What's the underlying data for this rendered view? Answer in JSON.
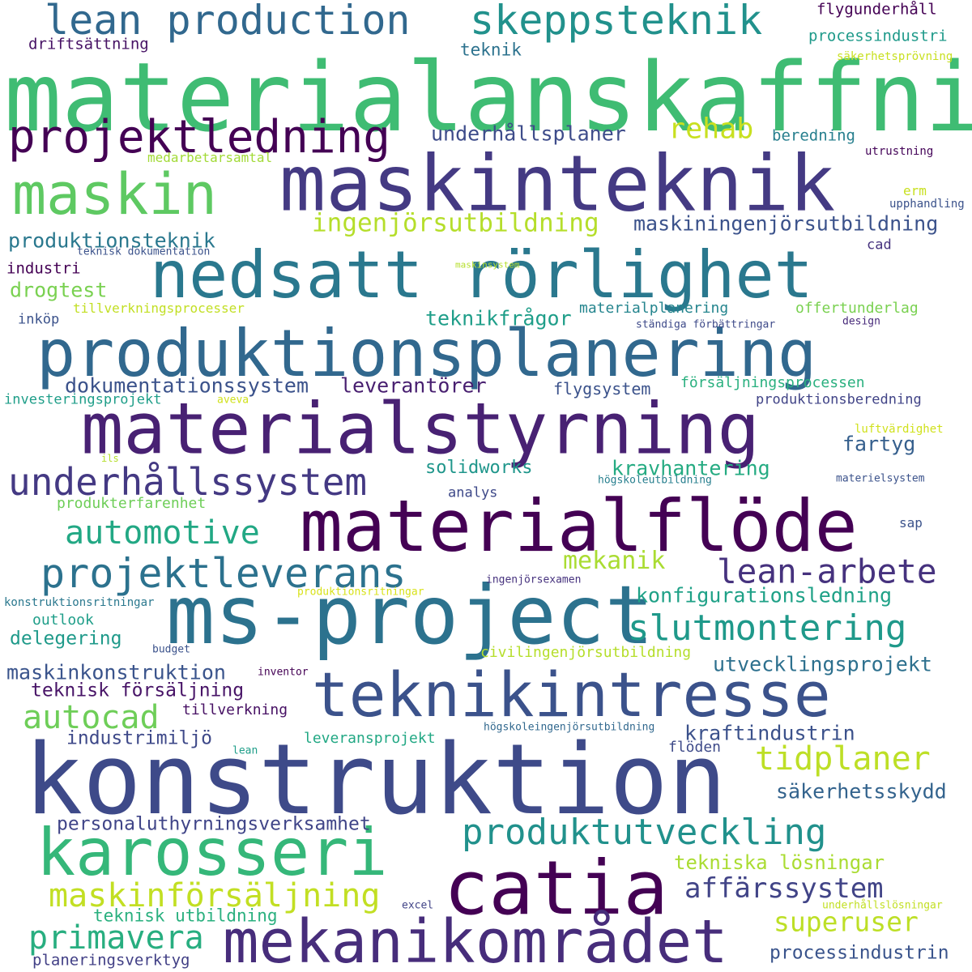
{
  "words": [
    {
      "text": "materialanskaffning",
      "color": "#3fbc73"
    },
    {
      "text": "maskinteknik",
      "color": "#443a83"
    },
    {
      "text": "nedsatt rörlighet",
      "color": "#2a788e"
    },
    {
      "text": "produktionsplanering",
      "color": "#31688e"
    },
    {
      "text": "materialstyrning",
      "color": "#482173"
    },
    {
      "text": "materialflöde",
      "color": "#440154"
    },
    {
      "text": "ms-project",
      "color": "#2c728e"
    },
    {
      "text": "teknikintresse",
      "color": "#3b528b"
    },
    {
      "text": "konstruktion",
      "color": "#3e4a89"
    },
    {
      "text": "karosseri",
      "color": "#35b779"
    },
    {
      "text": "catia",
      "color": "#440154"
    },
    {
      "text": "mekanikområdet",
      "color": "#472d7b"
    },
    {
      "text": "lean production",
      "color": "#31688e"
    },
    {
      "text": "skeppsteknik",
      "color": "#21918c"
    },
    {
      "text": "projektledning",
      "color": "#440154"
    },
    {
      "text": "maskin",
      "color": "#5ec962"
    },
    {
      "text": "underhållssystem",
      "color": "#443983"
    },
    {
      "text": "projektleverans",
      "color": "#2c728e"
    },
    {
      "text": "automotive",
      "color": "#22a884"
    },
    {
      "text": "slutmontering",
      "color": "#1f998a"
    },
    {
      "text": "lean-arbete",
      "color": "#46327e"
    },
    {
      "text": "produktutveckling",
      "color": "#21918c"
    },
    {
      "text": "autocad",
      "color": "#6ece58"
    },
    {
      "text": "tidplaner",
      "color": "#bddf26"
    },
    {
      "text": "maskinförsäljning",
      "color": "#c2df23"
    },
    {
      "text": "primavera",
      "color": "#28ae80"
    },
    {
      "text": "superuser",
      "color": "#bddf26"
    },
    {
      "text": "affärssystem",
      "color": "#414487"
    },
    {
      "text": "rehab",
      "color": "#c8e020"
    },
    {
      "text": "ingenjörsutbildning",
      "color": "#b5de2b"
    },
    {
      "text": "mekanik",
      "color": "#aadc32"
    },
    {
      "text": "underhållsplaner",
      "color": "#3e4c8a"
    },
    {
      "text": "maskiningenjörsutbildning",
      "color": "#3b528b"
    },
    {
      "text": "produktionsteknik",
      "color": "#2a788e"
    },
    {
      "text": "dokumentationssystem",
      "color": "#3b528b"
    },
    {
      "text": "leverantörer",
      "color": "#481f70"
    },
    {
      "text": "teknikfrågor",
      "color": "#1f9e89"
    },
    {
      "text": "drogtest",
      "color": "#7ad151"
    },
    {
      "text": "fartyg",
      "color": "#355f8d"
    },
    {
      "text": "solidworks",
      "color": "#1f968b"
    },
    {
      "text": "kravhantering",
      "color": "#25ab82"
    },
    {
      "text": "konfigurationsledning",
      "color": "#1fa187"
    },
    {
      "text": "utvecklingsprojekt",
      "color": "#2d708e"
    },
    {
      "text": "maskinkonstruktion",
      "color": "#3a548c"
    },
    {
      "text": "teknisk försäljning",
      "color": "#481467"
    },
    {
      "text": "industrimiljö",
      "color": "#3e4989"
    },
    {
      "text": "kraftindustrin",
      "color": "#3b518b"
    },
    {
      "text": "säkerhetsskydd",
      "color": "#33638d"
    },
    {
      "text": "personaluthyrningsverksamhet",
      "color": "#404588"
    },
    {
      "text": "tekniska lösningar",
      "color": "#aadc32"
    },
    {
      "text": "teknisk utbildning",
      "color": "#2ab07f"
    },
    {
      "text": "processindustrin",
      "color": "#3a548c"
    },
    {
      "text": "planeringsverktyg",
      "color": "#424086"
    },
    {
      "text": "flygunderhåll",
      "color": "#440154"
    },
    {
      "text": "processindustri",
      "color": "#1f9a8a"
    },
    {
      "text": "säkerhetsprövning",
      "color": "#c8e020"
    },
    {
      "text": "driftsättning",
      "color": "#471365"
    },
    {
      "text": "teknik",
      "color": "#2c728e"
    },
    {
      "text": "beredning",
      "color": "#277f8e"
    },
    {
      "text": "utrustning",
      "color": "#450559"
    },
    {
      "text": "medarbetarsamtal",
      "color": "#a2da37"
    },
    {
      "text": "erm",
      "color": "#c8e020"
    },
    {
      "text": "upphandling",
      "color": "#3b528b"
    },
    {
      "text": "cad",
      "color": "#46327e"
    },
    {
      "text": "maskinsystem",
      "color": "#b5de2b"
    },
    {
      "text": "teknisk dokumentation",
      "color": "#3b528b"
    },
    {
      "text": "industri",
      "color": "#440154"
    },
    {
      "text": "tillverkningsprocesser",
      "color": "#c2df23"
    },
    {
      "text": "materialplanering",
      "color": "#25858e"
    },
    {
      "text": "offertunderlag",
      "color": "#7ad151"
    },
    {
      "text": "inköp",
      "color": "#3b528b"
    },
    {
      "text": "ständiga förbättringar",
      "color": "#3e4a89"
    },
    {
      "text": "design",
      "color": "#472a7a"
    },
    {
      "text": "flygsystem",
      "color": "#3b528b"
    },
    {
      "text": "försäljningsprocessen",
      "color": "#2ab07f"
    },
    {
      "text": "investeringsprojekt",
      "color": "#1f9e89"
    },
    {
      "text": "aveva",
      "color": "#d0e11c"
    },
    {
      "text": "produktionsberedning",
      "color": "#414487"
    },
    {
      "text": "luftvärdighet",
      "color": "#d0e11c"
    },
    {
      "text": "ils",
      "color": "#b5de2b"
    },
    {
      "text": "högskoleutbildning",
      "color": "#277f8e"
    },
    {
      "text": "materielsystem",
      "color": "#3b528b"
    },
    {
      "text": "produkterfarenhet",
      "color": "#6ece58"
    },
    {
      "text": "analys",
      "color": "#3e4989"
    },
    {
      "text": "sap",
      "color": "#3b528b"
    },
    {
      "text": "ingenjörsexamen",
      "color": "#46327e"
    },
    {
      "text": "konstruktionsritningar",
      "color": "#2a788e"
    },
    {
      "text": "produktionsritningar",
      "color": "#d8e219"
    },
    {
      "text": "outlook",
      "color": "#1f9e89"
    },
    {
      "text": "delegering",
      "color": "#1f9a8a"
    },
    {
      "text": "budget",
      "color": "#3b528b"
    },
    {
      "text": "civilingenjörsutbildning",
      "color": "#b5de2b"
    },
    {
      "text": "inventor",
      "color": "#440154"
    },
    {
      "text": "tillverkning",
      "color": "#471164"
    },
    {
      "text": "högskoleingenjörsutbildning",
      "color": "#31688e"
    },
    {
      "text": "leveransprojekt",
      "color": "#22a884"
    },
    {
      "text": "lean",
      "color": "#1f9e89"
    },
    {
      "text": "flöden",
      "color": "#3e4a89"
    },
    {
      "text": "excel",
      "color": "#414487"
    },
    {
      "text": "underhållslösningar",
      "color": "#c2df23"
    }
  ]
}
